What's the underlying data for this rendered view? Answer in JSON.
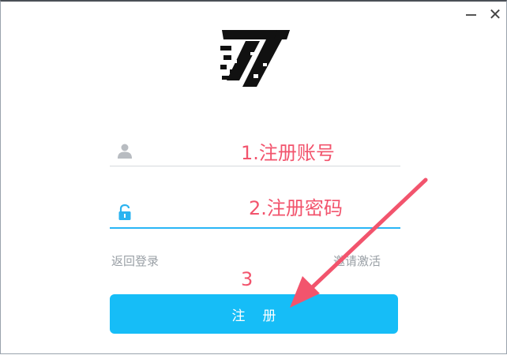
{
  "window": {
    "close_glyph": "✕"
  },
  "form": {
    "username_placeholder": "",
    "password_placeholder": "",
    "back_to_login": "返回登录",
    "invite_activate": "邀请激活",
    "register_label": "注册"
  },
  "annotations": {
    "step1": "1.注册账号",
    "step2": "2.注册密码",
    "step3": "3"
  },
  "icons": {
    "logo": "brand-logo",
    "user": "user-icon",
    "lock": "lock-icon",
    "minimize": "minimize-icon",
    "close": "close-icon",
    "arrow": "arrow-annotation"
  },
  "colors": {
    "accent": "#16bdf7",
    "annotation": "#f2546d",
    "link": "#9aa0a6"
  }
}
